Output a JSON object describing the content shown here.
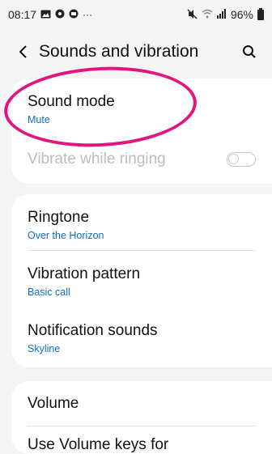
{
  "status_bar": {
    "time": "08:17",
    "left_icons": [
      "gallery-icon",
      "circle-icon",
      "circle-icon",
      "more-dots"
    ],
    "more": "···",
    "battery": "96%"
  },
  "header": {
    "title": "Sounds and vibration",
    "back_icon": "chevron-left-icon",
    "search_icon": "search-icon"
  },
  "settings": {
    "sound_mode": {
      "label": "Sound mode",
      "value": "Mute"
    },
    "vibrate_while_ringing": {
      "label": "Vibrate while ringing",
      "enabled": false,
      "disabled": true
    },
    "ringtone": {
      "label": "Ringtone",
      "value": "Over the Horizon"
    },
    "vibration_pattern": {
      "label": "Vibration pattern",
      "value": "Basic call"
    },
    "notification_sounds": {
      "label": "Notification sounds",
      "value": "Skyline"
    },
    "volume": {
      "label": "Volume"
    },
    "use_volume_keys": {
      "label": "Use Volume keys for"
    }
  },
  "colors": {
    "accent_sub": "#0b6fc4",
    "annotation": "#e0157f"
  }
}
